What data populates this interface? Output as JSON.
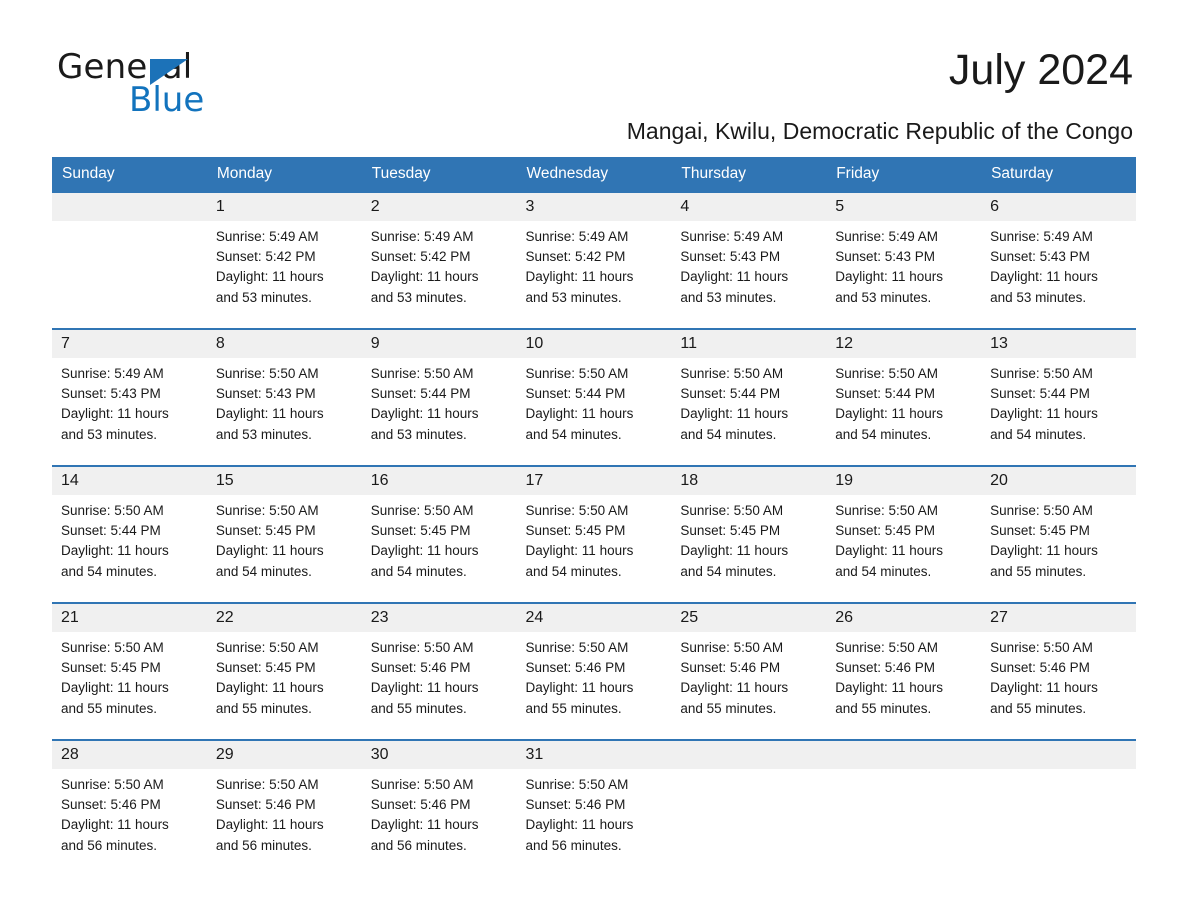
{
  "logo": {
    "word_one": "General",
    "word_two": "Blue",
    "triangle_color": "#1c72b8",
    "blue_text_color": "#1273bd"
  },
  "header": {
    "title": "July 2024",
    "location": "Mangai, Kwilu, Democratic Republic of the Congo",
    "header_bg_color": "#3075b4",
    "daynum_bg_color": "#f0f0f0"
  },
  "calendar": {
    "weekday_headers": [
      "Sunday",
      "Monday",
      "Tuesday",
      "Wednesday",
      "Thursday",
      "Friday",
      "Saturday"
    ],
    "weeks": [
      [
        {
          "day": "",
          "empty": true,
          "sunrise": "",
          "sunset": "",
          "daylight_line1": "",
          "daylight_line2": ""
        },
        {
          "day": "1",
          "sunrise": "Sunrise: 5:49 AM",
          "sunset": "Sunset: 5:42 PM",
          "daylight_line1": "Daylight: 11 hours",
          "daylight_line2": "and 53 minutes."
        },
        {
          "day": "2",
          "sunrise": "Sunrise: 5:49 AM",
          "sunset": "Sunset: 5:42 PM",
          "daylight_line1": "Daylight: 11 hours",
          "daylight_line2": "and 53 minutes."
        },
        {
          "day": "3",
          "sunrise": "Sunrise: 5:49 AM",
          "sunset": "Sunset: 5:42 PM",
          "daylight_line1": "Daylight: 11 hours",
          "daylight_line2": "and 53 minutes."
        },
        {
          "day": "4",
          "sunrise": "Sunrise: 5:49 AM",
          "sunset": "Sunset: 5:43 PM",
          "daylight_line1": "Daylight: 11 hours",
          "daylight_line2": "and 53 minutes."
        },
        {
          "day": "5",
          "sunrise": "Sunrise: 5:49 AM",
          "sunset": "Sunset: 5:43 PM",
          "daylight_line1": "Daylight: 11 hours",
          "daylight_line2": "and 53 minutes."
        },
        {
          "day": "6",
          "sunrise": "Sunrise: 5:49 AM",
          "sunset": "Sunset: 5:43 PM",
          "daylight_line1": "Daylight: 11 hours",
          "daylight_line2": "and 53 minutes."
        }
      ],
      [
        {
          "day": "7",
          "sunrise": "Sunrise: 5:49 AM",
          "sunset": "Sunset: 5:43 PM",
          "daylight_line1": "Daylight: 11 hours",
          "daylight_line2": "and 53 minutes."
        },
        {
          "day": "8",
          "sunrise": "Sunrise: 5:50 AM",
          "sunset": "Sunset: 5:43 PM",
          "daylight_line1": "Daylight: 11 hours",
          "daylight_line2": "and 53 minutes."
        },
        {
          "day": "9",
          "sunrise": "Sunrise: 5:50 AM",
          "sunset": "Sunset: 5:44 PM",
          "daylight_line1": "Daylight: 11 hours",
          "daylight_line2": "and 53 minutes."
        },
        {
          "day": "10",
          "sunrise": "Sunrise: 5:50 AM",
          "sunset": "Sunset: 5:44 PM",
          "daylight_line1": "Daylight: 11 hours",
          "daylight_line2": "and 54 minutes."
        },
        {
          "day": "11",
          "sunrise": "Sunrise: 5:50 AM",
          "sunset": "Sunset: 5:44 PM",
          "daylight_line1": "Daylight: 11 hours",
          "daylight_line2": "and 54 minutes."
        },
        {
          "day": "12",
          "sunrise": "Sunrise: 5:50 AM",
          "sunset": "Sunset: 5:44 PM",
          "daylight_line1": "Daylight: 11 hours",
          "daylight_line2": "and 54 minutes."
        },
        {
          "day": "13",
          "sunrise": "Sunrise: 5:50 AM",
          "sunset": "Sunset: 5:44 PM",
          "daylight_line1": "Daylight: 11 hours",
          "daylight_line2": "and 54 minutes."
        }
      ],
      [
        {
          "day": "14",
          "sunrise": "Sunrise: 5:50 AM",
          "sunset": "Sunset: 5:44 PM",
          "daylight_line1": "Daylight: 11 hours",
          "daylight_line2": "and 54 minutes."
        },
        {
          "day": "15",
          "sunrise": "Sunrise: 5:50 AM",
          "sunset": "Sunset: 5:45 PM",
          "daylight_line1": "Daylight: 11 hours",
          "daylight_line2": "and 54 minutes."
        },
        {
          "day": "16",
          "sunrise": "Sunrise: 5:50 AM",
          "sunset": "Sunset: 5:45 PM",
          "daylight_line1": "Daylight: 11 hours",
          "daylight_line2": "and 54 minutes."
        },
        {
          "day": "17",
          "sunrise": "Sunrise: 5:50 AM",
          "sunset": "Sunset: 5:45 PM",
          "daylight_line1": "Daylight: 11 hours",
          "daylight_line2": "and 54 minutes."
        },
        {
          "day": "18",
          "sunrise": "Sunrise: 5:50 AM",
          "sunset": "Sunset: 5:45 PM",
          "daylight_line1": "Daylight: 11 hours",
          "daylight_line2": "and 54 minutes."
        },
        {
          "day": "19",
          "sunrise": "Sunrise: 5:50 AM",
          "sunset": "Sunset: 5:45 PM",
          "daylight_line1": "Daylight: 11 hours",
          "daylight_line2": "and 54 minutes."
        },
        {
          "day": "20",
          "sunrise": "Sunrise: 5:50 AM",
          "sunset": "Sunset: 5:45 PM",
          "daylight_line1": "Daylight: 11 hours",
          "daylight_line2": "and 55 minutes."
        }
      ],
      [
        {
          "day": "21",
          "sunrise": "Sunrise: 5:50 AM",
          "sunset": "Sunset: 5:45 PM",
          "daylight_line1": "Daylight: 11 hours",
          "daylight_line2": "and 55 minutes."
        },
        {
          "day": "22",
          "sunrise": "Sunrise: 5:50 AM",
          "sunset": "Sunset: 5:45 PM",
          "daylight_line1": "Daylight: 11 hours",
          "daylight_line2": "and 55 minutes."
        },
        {
          "day": "23",
          "sunrise": "Sunrise: 5:50 AM",
          "sunset": "Sunset: 5:46 PM",
          "daylight_line1": "Daylight: 11 hours",
          "daylight_line2": "and 55 minutes."
        },
        {
          "day": "24",
          "sunrise": "Sunrise: 5:50 AM",
          "sunset": "Sunset: 5:46 PM",
          "daylight_line1": "Daylight: 11 hours",
          "daylight_line2": "and 55 minutes."
        },
        {
          "day": "25",
          "sunrise": "Sunrise: 5:50 AM",
          "sunset": "Sunset: 5:46 PM",
          "daylight_line1": "Daylight: 11 hours",
          "daylight_line2": "and 55 minutes."
        },
        {
          "day": "26",
          "sunrise": "Sunrise: 5:50 AM",
          "sunset": "Sunset: 5:46 PM",
          "daylight_line1": "Daylight: 11 hours",
          "daylight_line2": "and 55 minutes."
        },
        {
          "day": "27",
          "sunrise": "Sunrise: 5:50 AM",
          "sunset": "Sunset: 5:46 PM",
          "daylight_line1": "Daylight: 11 hours",
          "daylight_line2": "and 55 minutes."
        }
      ],
      [
        {
          "day": "28",
          "sunrise": "Sunrise: 5:50 AM",
          "sunset": "Sunset: 5:46 PM",
          "daylight_line1": "Daylight: 11 hours",
          "daylight_line2": "and 56 minutes."
        },
        {
          "day": "29",
          "sunrise": "Sunrise: 5:50 AM",
          "sunset": "Sunset: 5:46 PM",
          "daylight_line1": "Daylight: 11 hours",
          "daylight_line2": "and 56 minutes."
        },
        {
          "day": "30",
          "sunrise": "Sunrise: 5:50 AM",
          "sunset": "Sunset: 5:46 PM",
          "daylight_line1": "Daylight: 11 hours",
          "daylight_line2": "and 56 minutes."
        },
        {
          "day": "31",
          "sunrise": "Sunrise: 5:50 AM",
          "sunset": "Sunset: 5:46 PM",
          "daylight_line1": "Daylight: 11 hours",
          "daylight_line2": "and 56 minutes."
        },
        {
          "day": "",
          "empty": true,
          "sunrise": "",
          "sunset": "",
          "daylight_line1": "",
          "daylight_line2": ""
        },
        {
          "day": "",
          "empty": true,
          "sunrise": "",
          "sunset": "",
          "daylight_line1": "",
          "daylight_line2": ""
        },
        {
          "day": "",
          "empty": true,
          "sunrise": "",
          "sunset": "",
          "daylight_line1": "",
          "daylight_line2": ""
        }
      ]
    ]
  }
}
